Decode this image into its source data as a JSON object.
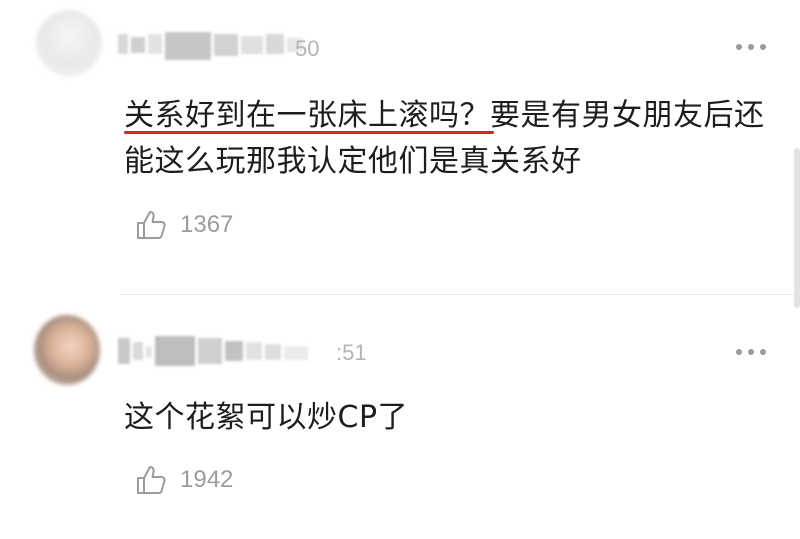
{
  "comments": [
    {
      "time": "50",
      "text": "关系好到在一张床上滚吗？要是有男女朋友后还能这么玩那我认定他们是真关系好",
      "likes": "1367"
    },
    {
      "time": ":51",
      "text": "这个花絮可以炒CP了",
      "likes": "1942"
    }
  ],
  "colors": {
    "underline": "#d6242a",
    "muted": "#9c9c9c",
    "text": "#1d1d1d"
  },
  "icons": {
    "more": "more-dots-icon",
    "like": "thumbs-up-icon"
  }
}
